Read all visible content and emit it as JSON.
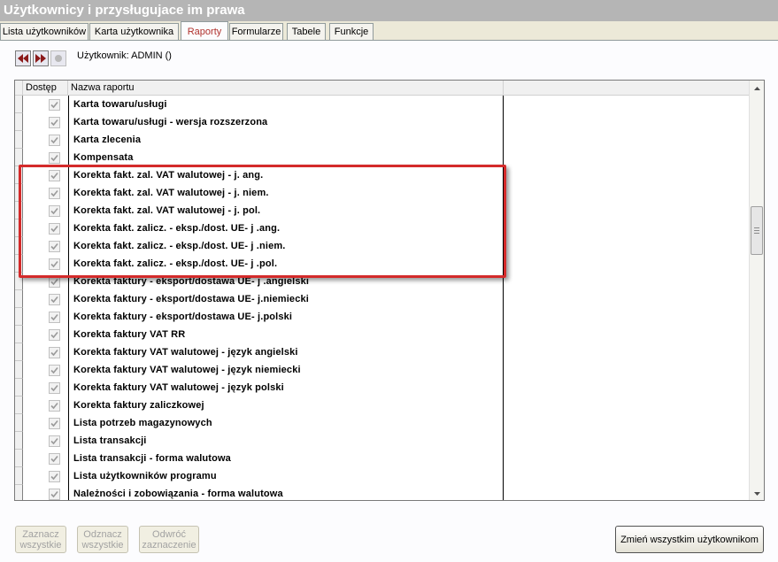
{
  "window": {
    "title": "Użytkownicy i przysługujace im prawa"
  },
  "tabs": [
    {
      "label": "Lista użytkowników",
      "active": false
    },
    {
      "label": "Karta użytkownika",
      "active": false
    },
    {
      "label": "Raporty",
      "active": true
    },
    {
      "label": "Formularze",
      "active": false
    },
    {
      "label": "Tabele",
      "active": false
    },
    {
      "label": "Funkcje",
      "active": false
    }
  ],
  "toolbar": {
    "user_label": "Użytkownik: ADMIN  ()"
  },
  "grid": {
    "columns": {
      "access": "Dostęp",
      "name": "Nazwa raportu"
    },
    "rows": [
      {
        "name": "Karta towaru/usługi",
        "checked": true
      },
      {
        "name": "Karta towaru/usługi - wersja rozszerzona",
        "checked": true
      },
      {
        "name": "Karta zlecenia",
        "checked": true
      },
      {
        "name": "Kompensata",
        "checked": true
      },
      {
        "name": "Korekta fakt. zal. VAT walutowej - j. ang.",
        "checked": true
      },
      {
        "name": "Korekta fakt. zal. VAT walutowej - j. niem.",
        "checked": true
      },
      {
        "name": "Korekta fakt. zal. VAT walutowej - j. pol.",
        "checked": true
      },
      {
        "name": "Korekta fakt. zalicz. - eksp./dost. UE- j .ang.",
        "checked": true
      },
      {
        "name": "Korekta fakt. zalicz. - eksp./dost. UE- j .niem.",
        "checked": true
      },
      {
        "name": "Korekta fakt. zalicz. - eksp./dost. UE- j .pol.",
        "checked": true
      },
      {
        "name": "Korekta faktury - eksport/dostawa UE- j .angielski",
        "checked": true
      },
      {
        "name": "Korekta faktury - eksport/dostawa UE- j.niemiecki",
        "checked": true
      },
      {
        "name": "Korekta faktury - eksport/dostawa UE- j.polski",
        "checked": true
      },
      {
        "name": "Korekta faktury VAT RR",
        "checked": true
      },
      {
        "name": "Korekta faktury VAT walutowej - język angielski",
        "checked": true
      },
      {
        "name": "Korekta faktury VAT walutowej - język niemiecki",
        "checked": true
      },
      {
        "name": "Korekta faktury VAT walutowej - język polski",
        "checked": true
      },
      {
        "name": "Korekta faktury zaliczkowej",
        "checked": true
      },
      {
        "name": "Lista potrzeb magazynowych",
        "checked": true
      },
      {
        "name": "Lista transakcji",
        "checked": true
      },
      {
        "name": "Lista transakcji  - forma walutowa",
        "checked": true
      },
      {
        "name": "Lista użytkowników programu",
        "checked": true
      },
      {
        "name": "Należności i zobowiązania - forma walutowa",
        "checked": true
      }
    ]
  },
  "buttons": {
    "select_all": {
      "line1": "Zaznacz",
      "line2": "wszystkie"
    },
    "deselect_all": {
      "line1": "Odznacz",
      "line2": "wszystkie"
    },
    "invert": {
      "line1": "Odwróć",
      "line2": "zaznaczenie"
    },
    "apply_all": "Zmień wszystkim użytkownikom"
  },
  "colors": {
    "highlight": "#d42a2a",
    "active_tab": "#b0312d"
  }
}
